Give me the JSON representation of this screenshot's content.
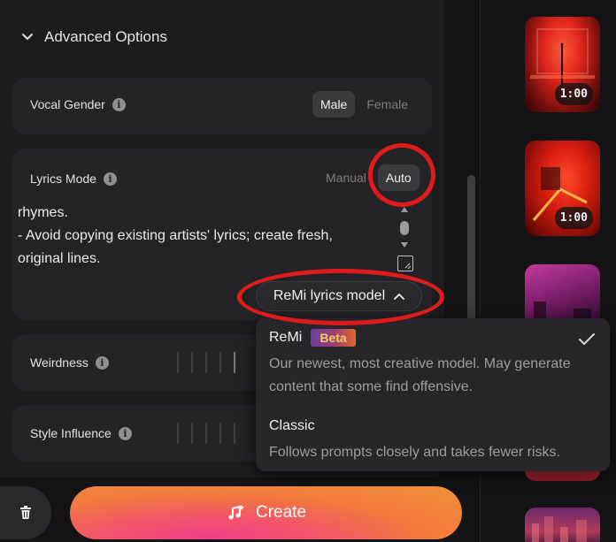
{
  "advanced": {
    "title": "Advanced Options"
  },
  "vocal_gender": {
    "label": "Vocal Gender",
    "options": [
      "Male",
      "Female"
    ],
    "selected": "Male"
  },
  "lyrics_mode": {
    "label": "Lyrics Mode",
    "options": [
      "Manual",
      "Auto"
    ],
    "selected": "Auto",
    "text_line1": "rhymes.",
    "text_line2": "- Avoid copying existing artists' lyrics; create fresh,",
    "text_line3": "original lines."
  },
  "model_button": {
    "label": "ReMi lyrics model"
  },
  "weirdness": {
    "label": "Weirdness"
  },
  "style_influence": {
    "label": "Style Influence"
  },
  "model_menu": {
    "options": [
      {
        "name": "ReMi",
        "badge": "Beta",
        "description_line1": "Our newest, most creative model. May generate",
        "description_line2": "content that some find offensive.",
        "selected": true
      },
      {
        "name": "Classic",
        "description_line1": "Follows prompts closely and takes fewer risks.",
        "selected": false
      }
    ]
  },
  "create": {
    "label": "Create"
  },
  "thumbnails": [
    {
      "duration": "1:00"
    },
    {
      "duration": "1:00"
    }
  ],
  "colors": {
    "accent_start": "#f03e8a",
    "accent_end": "#f0913a",
    "annotation": "#e01b1b"
  }
}
